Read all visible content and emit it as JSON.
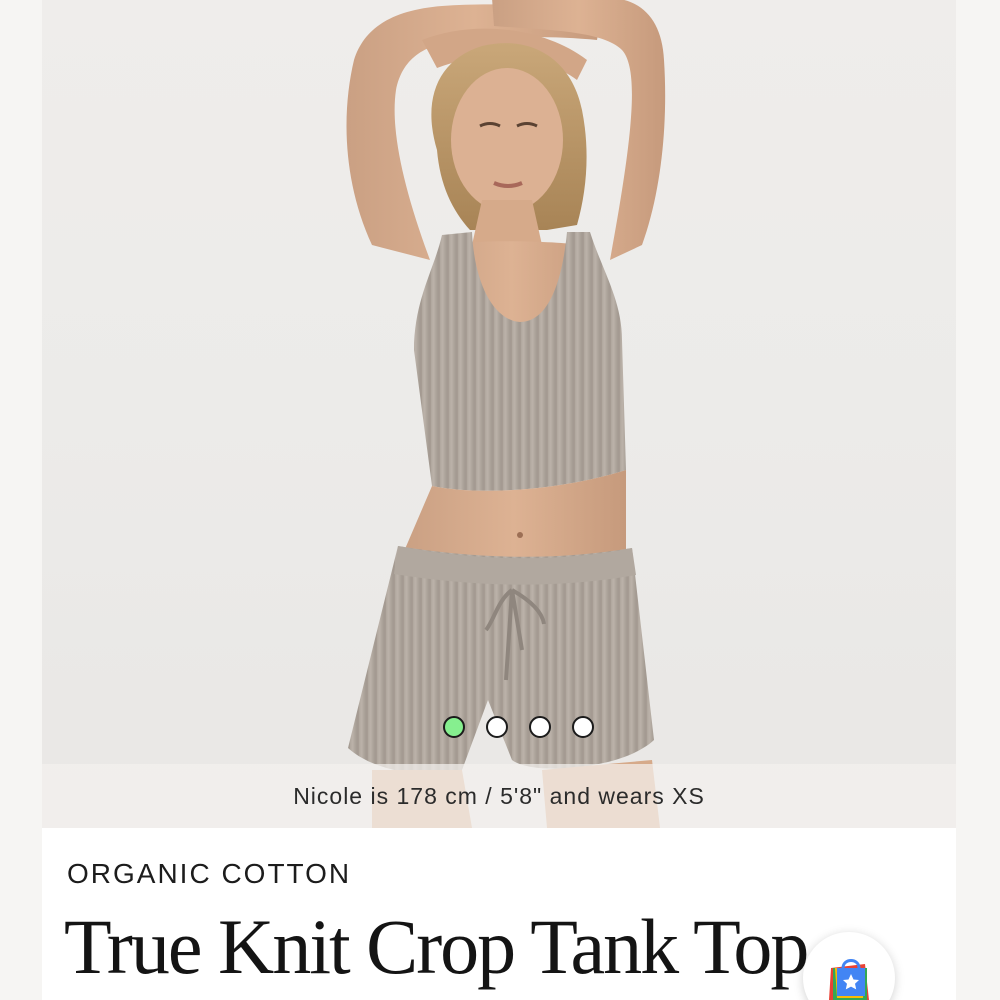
{
  "product": {
    "collection": "ORGANIC COTTON",
    "title": "True Knit Crop Tank Top",
    "model_caption": "Nicole is 178 cm / 5'8\" and wears XS"
  },
  "carousel": {
    "total": 4,
    "active_index": 0,
    "active_color": "#86ef8f"
  },
  "icons": {
    "fab": "shopping-bag-star-icon"
  },
  "colors": {
    "knit": "#b5aca3",
    "skin": "#d9a889",
    "backdrop": "#eceae8"
  }
}
